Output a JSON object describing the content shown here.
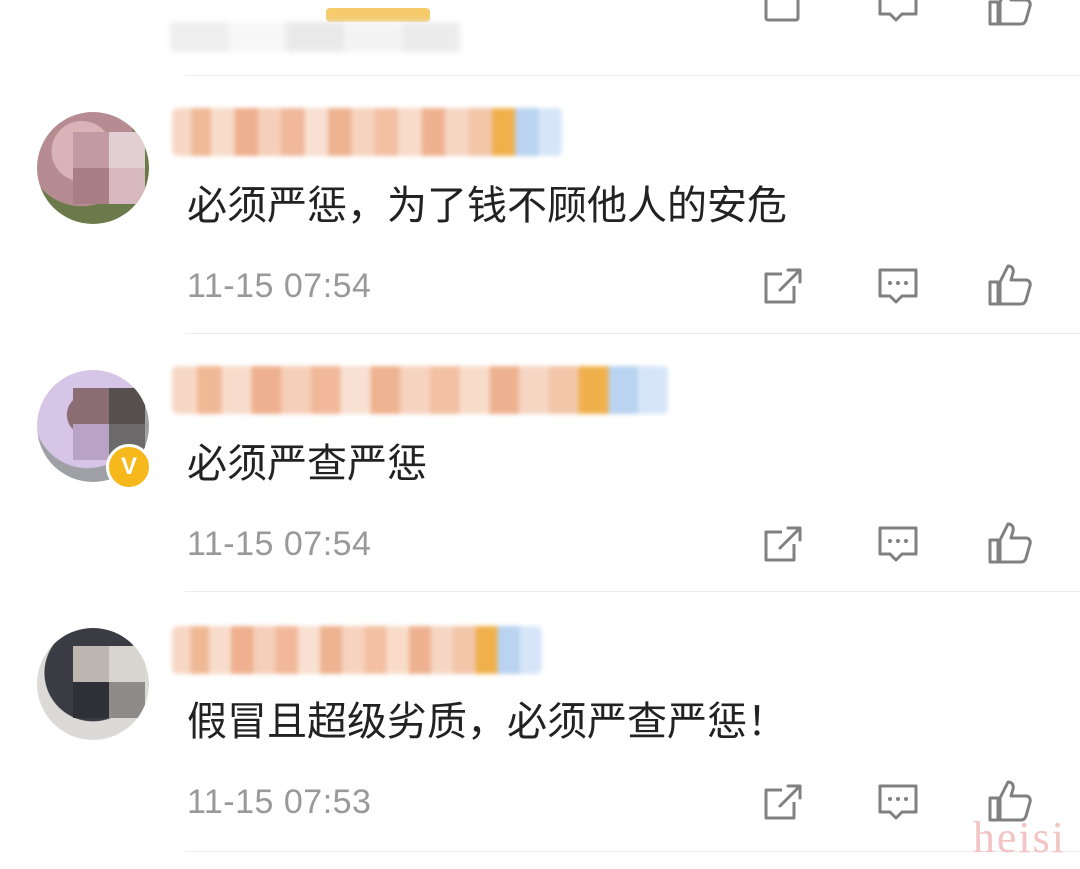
{
  "comments": [
    {
      "text": "必须严惩，为了钱不顾他人的安危",
      "time": "11-15 07:54",
      "verified": false
    },
    {
      "text": "必须严查严惩",
      "time": "11-15 07:54",
      "verified": true,
      "badge": "V"
    },
    {
      "text": "假冒且超级劣质，必须严查严惩！",
      "time": "11-15 07:53",
      "verified": false
    }
  ],
  "actions": {
    "share_icon": "share-icon",
    "reply_icon": "comment-icon",
    "like_icon": "thumbs-up-icon"
  },
  "watermark": "heisi",
  "colors": {
    "verified_badge": "#f6b81b",
    "time_text": "#999999",
    "icon": "#808080"
  }
}
